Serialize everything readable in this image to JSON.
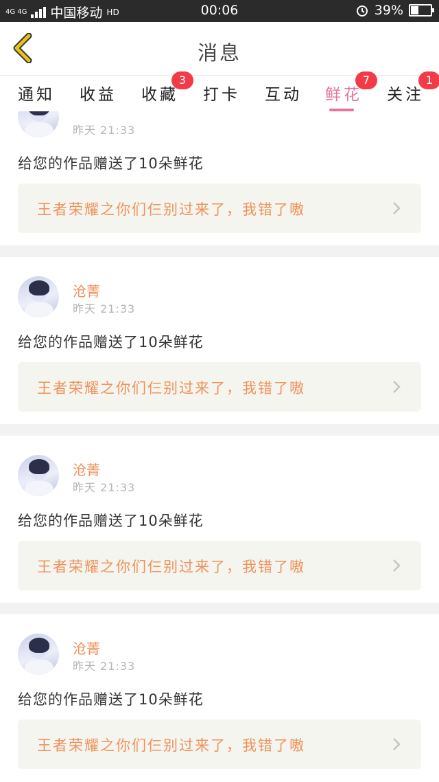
{
  "status_bar": {
    "network": "4G 4G",
    "carrier": "中国移动",
    "call": "HD",
    "time": "00:06",
    "battery_text": "39%",
    "battery_level": 0.39
  },
  "header": {
    "title": "消息"
  },
  "tabs": [
    {
      "label": "通知",
      "badge": ""
    },
    {
      "label": "收益",
      "badge": ""
    },
    {
      "label": "收藏",
      "badge": "3"
    },
    {
      "label": "打卡",
      "badge": ""
    },
    {
      "label": "互动",
      "badge": ""
    },
    {
      "label": "鲜花",
      "badge": "7",
      "active": true
    },
    {
      "label": "关注",
      "badge": "1"
    }
  ],
  "messages": [
    {
      "name": "",
      "time": "昨天 21:33",
      "text": "给您的作品赠送了10朵鲜花",
      "work": "王者荣耀之你们仨别过来了，我错了嗷"
    },
    {
      "name": "沧菁",
      "time": "昨天 21:33",
      "text": "给您的作品赠送了10朵鲜花",
      "work": "王者荣耀之你们仨别过来了，我错了嗷"
    },
    {
      "name": "沧菁",
      "time": "昨天 21:33",
      "text": "给您的作品赠送了10朵鲜花",
      "work": "王者荣耀之你们仨别过来了，我错了嗷"
    },
    {
      "name": "沧菁",
      "time": "昨天 21:33",
      "text": "给您的作品赠送了10朵鲜花",
      "work": "王者荣耀之你们仨别过来了，我错了嗷"
    }
  ],
  "colors": {
    "accent_pink": "#e8739c",
    "name_orange": "#f0915a",
    "badge_red": "#f33b48",
    "back_yellow": "#e8c21a"
  },
  "icons": {
    "back": "chevron-left-icon",
    "work_arrow": "chevron-right-icon",
    "alarm": "alarm-icon",
    "battery": "battery-icon",
    "signal": "signal-icon"
  }
}
